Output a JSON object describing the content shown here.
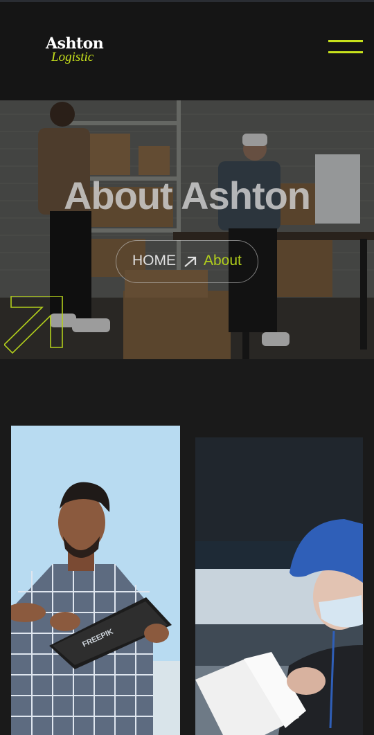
{
  "header": {
    "logo_main": "Ashton",
    "logo_sub": "Logistic",
    "menu_icon": "hamburger-menu-icon"
  },
  "hero": {
    "title": "About Ashton",
    "breadcrumb": {
      "home": "HOME",
      "separator_icon": "arrow-up-right-icon",
      "current": "About"
    },
    "decoration_icon": "arrow-up-right-outline-icon"
  },
  "colors": {
    "accent": "#c8e21c",
    "background": "#1a1a1a",
    "header_bg": "#151515"
  },
  "gallery": {
    "images": [
      {
        "name": "man-with-clipboard-photo",
        "watermark": "FREEPIK"
      },
      {
        "name": "courier-with-documents-photo",
        "watermark": ""
      }
    ]
  }
}
